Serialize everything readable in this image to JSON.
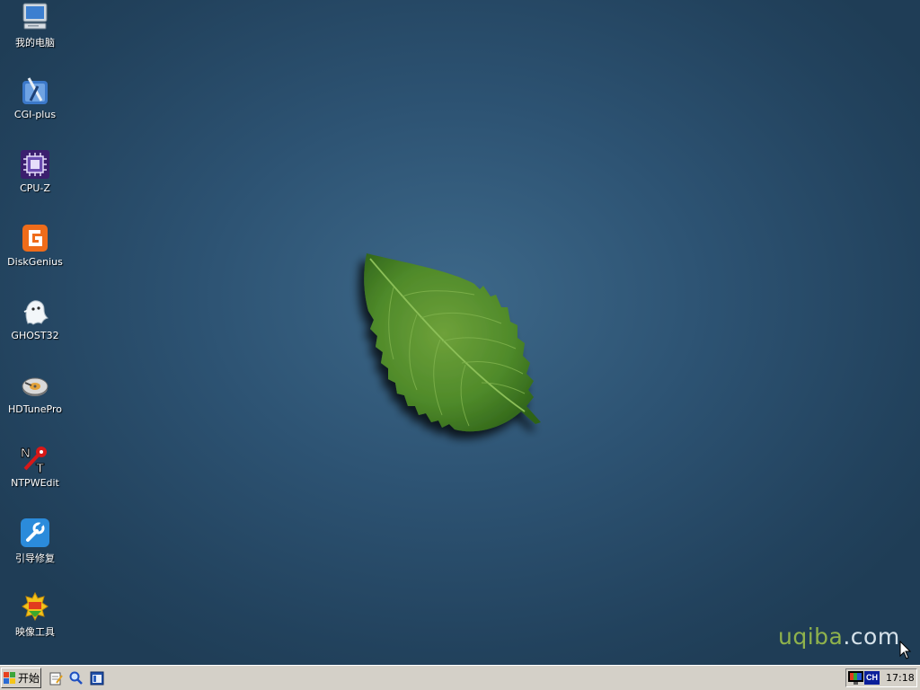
{
  "desktop": {
    "icons": [
      {
        "label": "我的电脑",
        "icon": "computer-icon"
      },
      {
        "label": "CGI-plus",
        "icon": "cgi-plus-icon"
      },
      {
        "label": "CPU-Z",
        "icon": "cpu-z-icon"
      },
      {
        "label": "DiskGenius",
        "icon": "diskgenius-icon"
      },
      {
        "label": "GHOST32",
        "icon": "ghost-icon"
      },
      {
        "label": "HDTunePro",
        "icon": "hdtune-icon"
      },
      {
        "label": "NTPWEdit",
        "icon": "ntpwedit-icon"
      },
      {
        "label": "引导修复",
        "icon": "wrench-icon"
      },
      {
        "label": "映像工具",
        "icon": "image-tool-icon"
      }
    ],
    "wallpaper": {
      "leaf_color": "#4f8a2a",
      "background": "#2d5373"
    },
    "watermark": {
      "part1": "uqiba",
      "part2": ".com"
    }
  },
  "taskbar": {
    "start_label": "开始",
    "quick_launch": [
      "notepad-icon",
      "search-icon",
      "window-icon"
    ],
    "tray": {
      "ime_label": "CH",
      "clock": "17:18"
    }
  }
}
